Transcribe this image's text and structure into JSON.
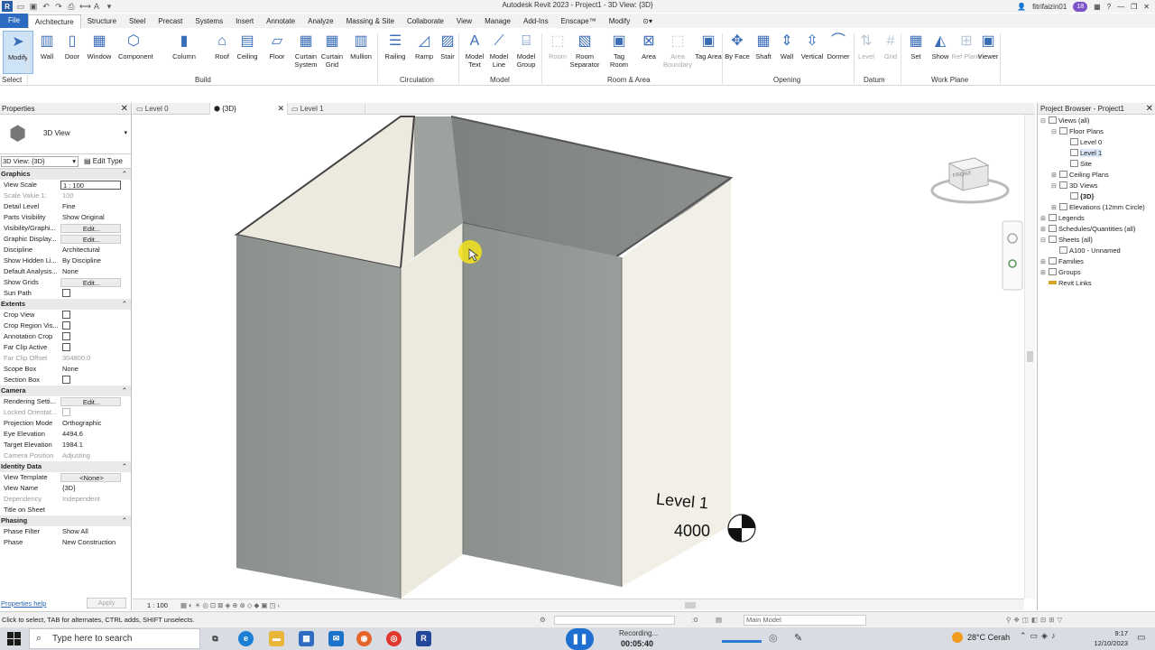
{
  "window": {
    "title": "Autodesk Revit 2023 - Project1 - 3D View: {3D}",
    "user": "fitrifaizin01",
    "badge_count": "18"
  },
  "menu_tabs": [
    "File",
    "Architecture",
    "Structure",
    "Steel",
    "Precast",
    "Systems",
    "Insert",
    "Annotate",
    "Analyze",
    "Massing & Site",
    "Collaborate",
    "View",
    "Manage",
    "Add-Ins",
    "Enscape™",
    "Modify"
  ],
  "ribbon": {
    "buttons": [
      {
        "label": "Modify",
        "icon": "cursor-arrow-icon"
      },
      {
        "label": "Wall",
        "icon": "wall-icon"
      },
      {
        "label": "Door",
        "icon": "door-icon"
      },
      {
        "label": "Window",
        "icon": "window-icon"
      },
      {
        "label": "Component",
        "icon": "component-icon"
      },
      {
        "label": "Column",
        "icon": "column-icon"
      },
      {
        "label": "Roof",
        "icon": "roof-icon"
      },
      {
        "label": "Ceiling",
        "icon": "ceiling-icon"
      },
      {
        "label": "Floor",
        "icon": "floor-icon"
      },
      {
        "label": "Curtain System",
        "icon": "curtain-system-icon"
      },
      {
        "label": "Curtain Grid",
        "icon": "curtain-grid-icon"
      },
      {
        "label": "Mullion",
        "icon": "mullion-icon"
      },
      {
        "label": "Railing",
        "icon": "railing-icon"
      },
      {
        "label": "Ramp",
        "icon": "ramp-icon"
      },
      {
        "label": "Stair",
        "icon": "stair-icon"
      },
      {
        "label": "Model Text",
        "icon": "model-text-icon"
      },
      {
        "label": "Model Line",
        "icon": "model-line-icon"
      },
      {
        "label": "Model Group",
        "icon": "model-group-icon"
      },
      {
        "label": "Room",
        "icon": "room-icon"
      },
      {
        "label": "Room Separator",
        "icon": "room-separator-icon"
      },
      {
        "label": "Tag Room",
        "icon": "tag-room-icon"
      },
      {
        "label": "Area",
        "icon": "area-icon"
      },
      {
        "label": "Area Boundary",
        "icon": "area-boundary-icon"
      },
      {
        "label": "Tag Area",
        "icon": "tag-area-icon"
      },
      {
        "label": "By Face",
        "icon": "by-face-icon"
      },
      {
        "label": "Shaft",
        "icon": "shaft-icon"
      },
      {
        "label": "Wall",
        "icon": "wall-opening-icon"
      },
      {
        "label": "Vertical",
        "icon": "vertical-opening-icon"
      },
      {
        "label": "Dormer",
        "icon": "dormer-icon"
      },
      {
        "label": "Level",
        "icon": "level-icon"
      },
      {
        "label": "Grid",
        "icon": "grid-icon"
      },
      {
        "label": "Set",
        "icon": "set-workplane-icon"
      },
      {
        "label": "Show",
        "icon": "show-workplane-icon"
      },
      {
        "label": "Ref Plane",
        "icon": "ref-plane-icon"
      },
      {
        "label": "Viewer",
        "icon": "viewer-icon"
      }
    ],
    "panels": [
      "Select",
      "Build",
      "Circulation",
      "Model",
      "Room & Area",
      "Opening",
      "Datum",
      "Work Plane"
    ]
  },
  "properties": {
    "header": "Properties",
    "type_name": "3D View",
    "instance_select": "3D View: {3D}",
    "edit_type": "Edit Type",
    "groups": [
      {
        "name": "Graphics",
        "rows": [
          {
            "k": "View Scale",
            "v": "1 : 100"
          },
          {
            "k": "Scale Value    1:",
            "v": "100"
          },
          {
            "k": "Detail Level",
            "v": "Fine"
          },
          {
            "k": "Parts Visibility",
            "v": "Show Original"
          },
          {
            "k": "Visibility/Graphi...",
            "v": "Edit..."
          },
          {
            "k": "Graphic Display...",
            "v": "Edit..."
          },
          {
            "k": "Discipline",
            "v": "Architectural"
          },
          {
            "k": "Show Hidden Li...",
            "v": "By Discipline"
          },
          {
            "k": "Default Analysis...",
            "v": "None"
          },
          {
            "k": "Show Grids",
            "v": "Edit..."
          },
          {
            "k": "Sun Path",
            "v": ""
          }
        ]
      },
      {
        "name": "Extents",
        "rows": [
          {
            "k": "Crop View",
            "v": ""
          },
          {
            "k": "Crop Region Vis...",
            "v": ""
          },
          {
            "k": "Annotation Crop",
            "v": ""
          },
          {
            "k": "Far Clip Active",
            "v": ""
          },
          {
            "k": "Far Clip Offset",
            "v": "304800.0"
          },
          {
            "k": "Scope Box",
            "v": "None"
          },
          {
            "k": "Section Box",
            "v": ""
          }
        ]
      },
      {
        "name": "Camera",
        "rows": [
          {
            "k": "Rendering Setti...",
            "v": "Edit..."
          },
          {
            "k": "Locked Orientat...",
            "v": ""
          },
          {
            "k": "Projection Mode",
            "v": "Orthographic"
          },
          {
            "k": "Eye Elevation",
            "v": "4494.6"
          },
          {
            "k": "Target Elevation",
            "v": "1984.1"
          },
          {
            "k": "Camera Position",
            "v": "Adjusting"
          }
        ]
      },
      {
        "name": "Identity Data",
        "rows": [
          {
            "k": "View Template",
            "v": "<None>"
          },
          {
            "k": "View Name",
            "v": "{3D}"
          },
          {
            "k": "Dependency",
            "v": "Independent"
          },
          {
            "k": "Title on Sheet",
            "v": ""
          }
        ]
      },
      {
        "name": "Phasing",
        "rows": [
          {
            "k": "Phase Filter",
            "v": "Show All"
          },
          {
            "k": "Phase",
            "v": "New Construction"
          }
        ]
      }
    ],
    "help_link": "Properties help",
    "apply": "Apply"
  },
  "view_tabs": [
    {
      "label": "Level 0"
    },
    {
      "label": "{3D}"
    },
    {
      "label": "Level 1"
    }
  ],
  "canvas": {
    "level_label": "Level 1",
    "level_value": "4000",
    "viewcube_label": "FRONT",
    "scale": "1 : 100"
  },
  "project_browser": {
    "header": "Project Browser - Project1",
    "tree": [
      {
        "label": "Views (all)",
        "depth": 0,
        "exp": "⊟"
      },
      {
        "label": "Floor Plans",
        "depth": 1,
        "exp": "⊟"
      },
      {
        "label": "Level 0",
        "depth": 2,
        "exp": ""
      },
      {
        "label": "Level 1",
        "depth": 2,
        "exp": ""
      },
      {
        "label": "Site",
        "depth": 2,
        "exp": ""
      },
      {
        "label": "Ceiling Plans",
        "depth": 1,
        "exp": "⊞"
      },
      {
        "label": "3D Views",
        "depth": 1,
        "exp": "⊟"
      },
      {
        "label": "{3D}",
        "depth": 2,
        "exp": ""
      },
      {
        "label": "Elevations (12mm Circle)",
        "depth": 1,
        "exp": "⊞"
      },
      {
        "label": "Legends",
        "depth": 0,
        "exp": "⊞"
      },
      {
        "label": "Schedules/Quantities (all)",
        "depth": 0,
        "exp": "⊞"
      },
      {
        "label": "Sheets (all)",
        "depth": 0,
        "exp": "⊟"
      },
      {
        "label": "A100 - Unnamed",
        "depth": 1,
        "exp": ""
      },
      {
        "label": "Families",
        "depth": 0,
        "exp": "⊞"
      },
      {
        "label": "Groups",
        "depth": 0,
        "exp": "⊞"
      },
      {
        "label": "Revit Links",
        "depth": 0,
        "exp": ""
      }
    ]
  },
  "status": {
    "message": "Click to select, TAB for alternates, CTRL adds, SHIFT unselects.",
    "zero": ":0",
    "model": "Main Model"
  },
  "taskbar": {
    "search_placeholder": "Type here to search",
    "recording_label": "Recording...",
    "recording_time": "00:05:40",
    "weather": "28°C  Cerah",
    "time": "9:17",
    "date": "12/10/2023"
  },
  "colors": {
    "file_tab": "#2c6bc2",
    "ribbon_icon": "#3a6db8",
    "wall_face_dark": "#8e9390",
    "wall_face_light": "#f1efe6",
    "taskbar": "#d9dde3"
  }
}
